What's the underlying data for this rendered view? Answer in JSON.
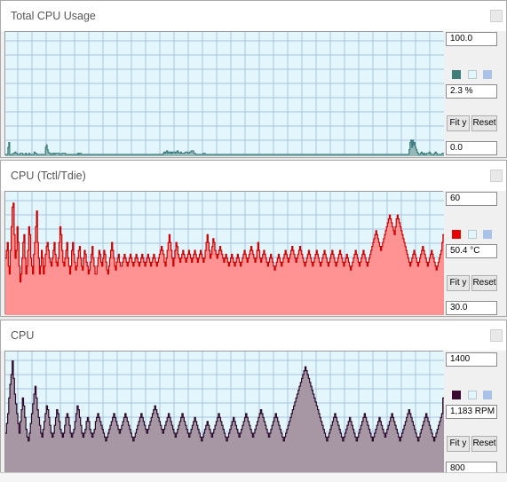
{
  "panels": [
    {
      "title": "Total CPU Usage",
      "max_value": "100.0",
      "current": "2.3 %",
      "min_value": "0.0",
      "fit_label": "Fit y",
      "reset_label": "Reset",
      "line_color": "#3f7f7f",
      "fill_color": "#97b8b8",
      "swatch_color": "#3e7f7c",
      "ymin": 0,
      "ymax": 100,
      "series": [
        0,
        0,
        0,
        6,
        10,
        0,
        0,
        0,
        0,
        1,
        1,
        2,
        1,
        1,
        0,
        0,
        0,
        1,
        1,
        1,
        0,
        0,
        0,
        1,
        0,
        0,
        0,
        1,
        0,
        0,
        0,
        0,
        0,
        2,
        1,
        1,
        0,
        0,
        0,
        0,
        0,
        0,
        0,
        0,
        0,
        0,
        6,
        8,
        4,
        2,
        1,
        1,
        0,
        0,
        1,
        1,
        0,
        1,
        1,
        1,
        1,
        1,
        0,
        0,
        0,
        1,
        1,
        1,
        1,
        0,
        0,
        0,
        0,
        0,
        0,
        0,
        0,
        0,
        0,
        0,
        0,
        0,
        0,
        1,
        0,
        1,
        1,
        0,
        0,
        0,
        0,
        0,
        0,
        0,
        0,
        0,
        0,
        0,
        0,
        0,
        0,
        0,
        0,
        0,
        0,
        0,
        0,
        0,
        0,
        0,
        0,
        0,
        0,
        0,
        0,
        0,
        0,
        0,
        0,
        0,
        0,
        0,
        0,
        0,
        0,
        0,
        0,
        0,
        0,
        0,
        0,
        0,
        0,
        0,
        0,
        0,
        0,
        0,
        0,
        0,
        0,
        0,
        0,
        0,
        0,
        0,
        0,
        0,
        0,
        0,
        0,
        0,
        0,
        0,
        0,
        0,
        0,
        0,
        0,
        0,
        0,
        0,
        0,
        0,
        0,
        0,
        0,
        0,
        0,
        0,
        0,
        0,
        0,
        0,
        0,
        0,
        0,
        0,
        0,
        0,
        0,
        1,
        2,
        1,
        2,
        3,
        1,
        2,
        2,
        1,
        2,
        1,
        2,
        2,
        2,
        1,
        2,
        3,
        2,
        1,
        1,
        2,
        1,
        1,
        1,
        1,
        2,
        2,
        2,
        1,
        1,
        2,
        2,
        3,
        3,
        3,
        1,
        1,
        0,
        0,
        0,
        0,
        0,
        0,
        0,
        0,
        0,
        1,
        1,
        0,
        0,
        0,
        0,
        0,
        0,
        0,
        0,
        0,
        0,
        0,
        0,
        0,
        0,
        0,
        0,
        0,
        0,
        0,
        0,
        0,
        0,
        0,
        0,
        0,
        0,
        0,
        0,
        0,
        0,
        0,
        0,
        0,
        0,
        0,
        0,
        0,
        0,
        0,
        0,
        0,
        0,
        0,
        0,
        0,
        0,
        0,
        0,
        0,
        0,
        0,
        0,
        0,
        0,
        0,
        0,
        0,
        0,
        0,
        0,
        0,
        0,
        0,
        0,
        0,
        0,
        0,
        0,
        0,
        0,
        0,
        0,
        0,
        0,
        0,
        0,
        0,
        0,
        0,
        0,
        0,
        0,
        0,
        0,
        0,
        0,
        0,
        0,
        0,
        0,
        0,
        0,
        0,
        0,
        0,
        0,
        0,
        0,
        0,
        0,
        0,
        0,
        0,
        0,
        0,
        0,
        0,
        0,
        0,
        0,
        0,
        0,
        0,
        0,
        0,
        0,
        0,
        0,
        0,
        0,
        0,
        0,
        0,
        0,
        0,
        0,
        0,
        0,
        0,
        0,
        0,
        0,
        0,
        0,
        0,
        0,
        0,
        0,
        0,
        0,
        0,
        0,
        0,
        0,
        0,
        0,
        0,
        0,
        0,
        0,
        0,
        0,
        0,
        0,
        0,
        0,
        0,
        0,
        0,
        0,
        0,
        0,
        0,
        0,
        0,
        0,
        0,
        0,
        0,
        0,
        0,
        0,
        0,
        0,
        0,
        0,
        0,
        0,
        0,
        0,
        0,
        0,
        0,
        0,
        0,
        0,
        0,
        0,
        0,
        0,
        0,
        0,
        0,
        0,
        0,
        0,
        0,
        0,
        0,
        0,
        0,
        0,
        0,
        0,
        0,
        0,
        0,
        0,
        0,
        0,
        0,
        0,
        0,
        0,
        0,
        0,
        0,
        0,
        0,
        0,
        0,
        0,
        0,
        0,
        0,
        0,
        0,
        0,
        0,
        0,
        0,
        0,
        0,
        0,
        4,
        10,
        12,
        6,
        12,
        8,
        10,
        6,
        4,
        2,
        1,
        0,
        0,
        1,
        2,
        1,
        0,
        1,
        0,
        0,
        1,
        1,
        1,
        2,
        1,
        0,
        0,
        0,
        0,
        1,
        2,
        1,
        0,
        0,
        0,
        0,
        0,
        0,
        1,
        1
      ]
    },
    {
      "title": "CPU (Tctl/Tdie)",
      "max_value": "60",
      "current": "50.4 °C",
      "min_value": "30.0",
      "fit_label": "Fit y",
      "reset_label": "Reset",
      "line_color": "#cc0000",
      "fill_color": "#ff9292",
      "swatch_color": "#e60000",
      "ymin": 30,
      "ymax": 60,
      "series": [
        44,
        46,
        48,
        42,
        40,
        46,
        52,
        57,
        58,
        50,
        44,
        46,
        52,
        48,
        42,
        38,
        40,
        44,
        48,
        50,
        44,
        40,
        42,
        46,
        52,
        50,
        44,
        42,
        40,
        45,
        48,
        52,
        56,
        48,
        44,
        40,
        42,
        46,
        44,
        40,
        42,
        45,
        47,
        48,
        46,
        44,
        43,
        42,
        44,
        46,
        48,
        45,
        43,
        42,
        44,
        48,
        52,
        50,
        46,
        43,
        42,
        44,
        46,
        48,
        44,
        42,
        40,
        42,
        46,
        48,
        45,
        43,
        41,
        42,
        44,
        46,
        47,
        44,
        42,
        41,
        44,
        46,
        45,
        43,
        42,
        40,
        41,
        43,
        45,
        47,
        44,
        42,
        40,
        40,
        42,
        44,
        46,
        45,
        43,
        42,
        44,
        46,
        45,
        43,
        41,
        40,
        42,
        44,
        46,
        48,
        46,
        44,
        42,
        41,
        43,
        44,
        45,
        43,
        42,
        42,
        43,
        44,
        45,
        44,
        43,
        42,
        43,
        44,
        45,
        44,
        43,
        42,
        43,
        44,
        45,
        44,
        43,
        42,
        43,
        44,
        45,
        44,
        43,
        42,
        43,
        44,
        45,
        44,
        43,
        42,
        43,
        44,
        45,
        44,
        43,
        42,
        43,
        44,
        45,
        46,
        47,
        46,
        45,
        43,
        42,
        44,
        46,
        48,
        50,
        48,
        46,
        44,
        42,
        44,
        46,
        48,
        47,
        45,
        44,
        43,
        44,
        45,
        46,
        45,
        44,
        43,
        44,
        45,
        46,
        45,
        44,
        43,
        44,
        45,
        46,
        45,
        44,
        43,
        44,
        45,
        46,
        45,
        44,
        43,
        44,
        46,
        48,
        50,
        48,
        46,
        44,
        45,
        47,
        49,
        48,
        46,
        45,
        44,
        45,
        46,
        47,
        46,
        45,
        44,
        43,
        44,
        45,
        44,
        43,
        42,
        43,
        44,
        45,
        44,
        43,
        42,
        43,
        44,
        45,
        44,
        43,
        42,
        43,
        44,
        45,
        46,
        45,
        44,
        43,
        44,
        45,
        46,
        47,
        46,
        45,
        44,
        43,
        44,
        46,
        48,
        46,
        44,
        43,
        44,
        45,
        46,
        45,
        44,
        43,
        42,
        43,
        44,
        45,
        44,
        43,
        42,
        41,
        42,
        43,
        44,
        45,
        44,
        43,
        42,
        43,
        44,
        45,
        46,
        45,
        44,
        43,
        44,
        45,
        46,
        47,
        46,
        45,
        44,
        43,
        44,
        45,
        46,
        47,
        46,
        45,
        44,
        43,
        42,
        43,
        44,
        45,
        46,
        45,
        44,
        43,
        42,
        43,
        44,
        45,
        46,
        45,
        44,
        43,
        42,
        43,
        44,
        45,
        46,
        45,
        44,
        43,
        42,
        43,
        44,
        45,
        46,
        45,
        44,
        43,
        42,
        43,
        44,
        45,
        46,
        45,
        44,
        43,
        42,
        43,
        44,
        45,
        44,
        43,
        42,
        41,
        42,
        43,
        44,
        45,
        46,
        45,
        44,
        43,
        42,
        43,
        44,
        45,
        46,
        45,
        44,
        43,
        42,
        43,
        44,
        45,
        46,
        47,
        48,
        49,
        50,
        51,
        50,
        49,
        48,
        47,
        46,
        47,
        48,
        49,
        50,
        51,
        52,
        53,
        54,
        55,
        54,
        53,
        52,
        51,
        50,
        52,
        54,
        55,
        54,
        53,
        52,
        51,
        50,
        49,
        48,
        47,
        46,
        45,
        44,
        43,
        42,
        43,
        44,
        45,
        46,
        45,
        44,
        43,
        42,
        43,
        44,
        45,
        46,
        47,
        46,
        45,
        44,
        43,
        42,
        43,
        44,
        45,
        46,
        45,
        44,
        43,
        42,
        41,
        42,
        43,
        44,
        45,
        46,
        48,
        50
      ]
    },
    {
      "title": "CPU",
      "max_value": "1400",
      "current": "1,183 RPM",
      "min_value": "800",
      "fit_label": "Fit y",
      "reset_label": "Reset",
      "line_color": "#2b0a2b",
      "fill_color": "#a797a5",
      "swatch_color": "#3b0a30",
      "ymin": 800,
      "ymax": 1400,
      "series": [
        1000,
        1050,
        1100,
        1180,
        1250,
        1300,
        1370,
        1280,
        1200,
        1150,
        1100,
        1050,
        1000,
        1060,
        1120,
        1180,
        1140,
        1080,
        1020,
        980,
        960,
        1000,
        1050,
        1100,
        1150,
        1200,
        1240,
        1180,
        1120,
        1080,
        1040,
        1000,
        980,
        1020,
        1060,
        1100,
        1140,
        1120,
        1080,
        1040,
        1000,
        980,
        1000,
        1040,
        1080,
        1120,
        1100,
        1060,
        1020,
        1000,
        980,
        1000,
        1040,
        1080,
        1100,
        1080,
        1040,
        1000,
        980,
        1000,
        1020,
        1060,
        1100,
        1140,
        1120,
        1080,
        1040,
        1000,
        980,
        1000,
        1020,
        1060,
        1080,
        1060,
        1020,
        1000,
        980,
        1000,
        1020,
        1060,
        1080,
        1100,
        1080,
        1060,
        1040,
        1020,
        1000,
        980,
        960,
        980,
        1000,
        1020,
        1040,
        1060,
        1080,
        1100,
        1080,
        1060,
        1040,
        1020,
        1000,
        1020,
        1040,
        1060,
        1080,
        1100,
        1080,
        1060,
        1040,
        1020,
        1000,
        980,
        960,
        980,
        1000,
        1020,
        1040,
        1060,
        1080,
        1100,
        1080,
        1060,
        1040,
        1020,
        1000,
        1020,
        1040,
        1060,
        1080,
        1100,
        1120,
        1140,
        1120,
        1100,
        1080,
        1060,
        1040,
        1020,
        1000,
        1020,
        1040,
        1060,
        1080,
        1100,
        1080,
        1060,
        1040,
        1020,
        1000,
        980,
        1000,
        1020,
        1040,
        1060,
        1080,
        1100,
        1080,
        1060,
        1040,
        1020,
        1000,
        980,
        1000,
        1020,
        1040,
        1060,
        1080,
        1060,
        1040,
        1020,
        1000,
        980,
        960,
        980,
        1000,
        1020,
        1040,
        1060,
        1040,
        1020,
        1000,
        980,
        1000,
        1020,
        1040,
        1060,
        1080,
        1100,
        1080,
        1060,
        1040,
        1020,
        1000,
        980,
        960,
        980,
        1000,
        1020,
        1040,
        1060,
        1080,
        1060,
        1040,
        1020,
        1000,
        980,
        1000,
        1020,
        1040,
        1060,
        1080,
        1100,
        1080,
        1060,
        1040,
        1020,
        1000,
        980,
        1000,
        1020,
        1040,
        1060,
        1080,
        1100,
        1120,
        1100,
        1080,
        1060,
        1040,
        1020,
        1000,
        980,
        1000,
        1020,
        1040,
        1060,
        1080,
        1100,
        1080,
        1060,
        1040,
        1020,
        1000,
        980,
        960,
        980,
        1000,
        1020,
        1040,
        1060,
        1080,
        1100,
        1120,
        1140,
        1160,
        1180,
        1200,
        1220,
        1240,
        1260,
        1280,
        1300,
        1320,
        1340,
        1320,
        1300,
        1280,
        1260,
        1240,
        1220,
        1200,
        1180,
        1160,
        1140,
        1120,
        1100,
        1080,
        1060,
        1040,
        1020,
        1000,
        980,
        960,
        980,
        1000,
        1020,
        1040,
        1060,
        1080,
        1100,
        1080,
        1060,
        1040,
        1020,
        1000,
        980,
        960,
        980,
        1000,
        1020,
        1040,
        1060,
        1080,
        1060,
        1040,
        1020,
        1000,
        980,
        960,
        980,
        1000,
        1020,
        1040,
        1060,
        1080,
        1100,
        1080,
        1060,
        1040,
        1020,
        1000,
        980,
        960,
        980,
        1000,
        1020,
        1040,
        1060,
        1080,
        1060,
        1040,
        1020,
        1000,
        980,
        1000,
        1020,
        1040,
        1060,
        1080,
        1100,
        1080,
        1060,
        1040,
        1020,
        1000,
        980,
        960,
        980,
        1000,
        1020,
        1040,
        1060,
        1080,
        1100,
        1120,
        1100,
        1080,
        1060,
        1040,
        1020,
        1000,
        980,
        960,
        980,
        1000,
        1020,
        1040,
        1060,
        1080,
        1100,
        1080,
        1060,
        1040,
        1020,
        1000,
        980,
        960,
        980,
        1000,
        1020,
        1040,
        1060,
        1080,
        1100,
        1180
      ]
    }
  ]
}
